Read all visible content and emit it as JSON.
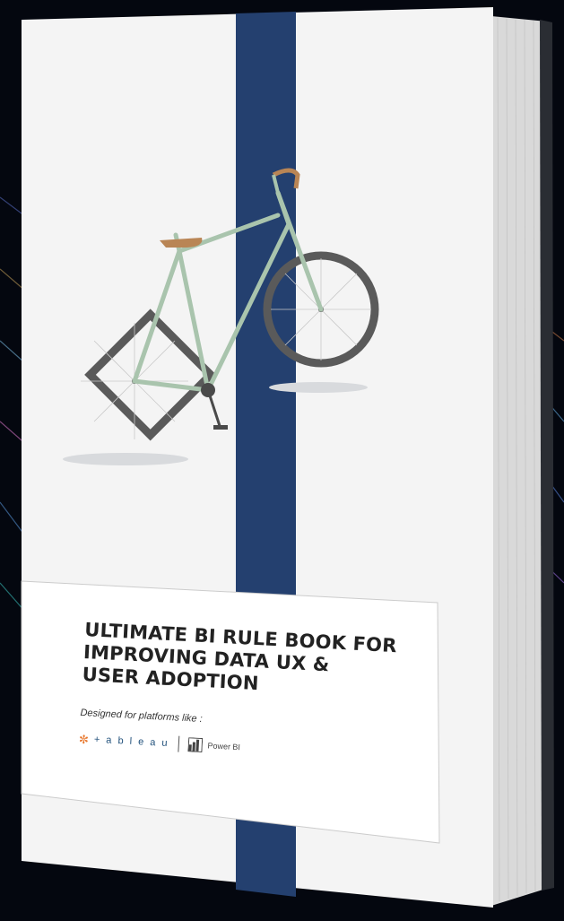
{
  "cover": {
    "title_lines": [
      "ULTIMATE BI RULE BOOK FOR",
      "IMPROVING DATA UX &",
      "USER ADOPTION"
    ],
    "designed_for": "Designed for platforms like :",
    "platforms": {
      "tableau": "+ a b l e a u",
      "powerbi": "Power BI"
    }
  },
  "colors": {
    "background": "#04070f",
    "stripe": "#24406f",
    "bike_frame": "#a9c4ad",
    "wheel": "#5a5a5a",
    "saddle": "#b98555"
  }
}
